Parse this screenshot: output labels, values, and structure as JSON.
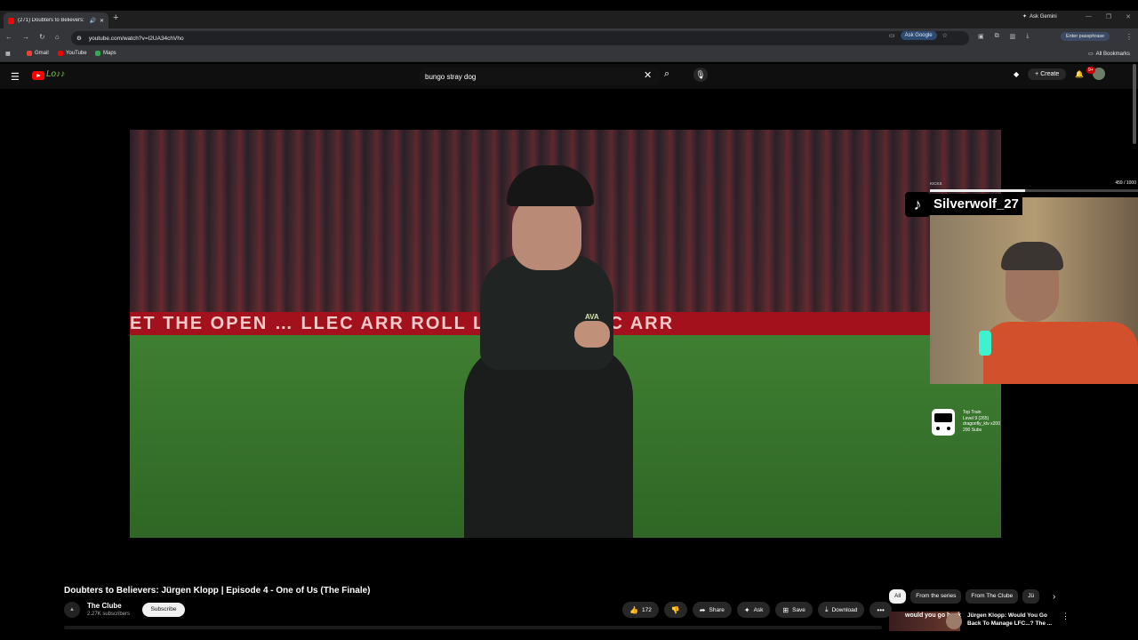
{
  "browser": {
    "tab_title": "(271) Doubters to Believers:",
    "new_tab": "+",
    "ask_gemini": "Ask Gemini",
    "url": "youtube.com/watch?v=I2UA34chVho",
    "ask_google": "Ask Google",
    "passphrase": "Enter passphrase",
    "bookmarks": [
      {
        "label": "Gmail",
        "color": "#ea4335"
      },
      {
        "label": "YouTube",
        "color": "#ff0000"
      },
      {
        "label": "Maps",
        "color": "#34a853"
      }
    ],
    "all_bookmarks": "All Bookmarks"
  },
  "youtube": {
    "search_query": "bungo stray dog",
    "create_label": "Create",
    "notif_badge": "9+",
    "doodle": "Lo♪♪"
  },
  "video": {
    "adboard_text": "ET THE OPEN … LLEC ARR          ROLL LEC ARR     LLEC ARR",
    "kick_player": "AVA"
  },
  "overlay": {
    "kicks_label": "KICKS",
    "kicks_count": "459 / 1000",
    "kicks_progress": 0.459,
    "tiktok_username": "Silverwolf_27",
    "train_title": "Top Train",
    "train_level": "Level 9 (265)",
    "train_user": "dragonfly_ktv x200",
    "train_subs": "200 Subs"
  },
  "info": {
    "title": "Doubters to Believers: Jürgen Klopp | Episode 4 - One of Us (The Finale)",
    "channel": "The Clube",
    "subscribers": "2.27K subscribers",
    "subscribe": "Subscribe",
    "actions": [
      {
        "icon": "thumbs-up-icon",
        "glyph": "👍",
        "label": "172"
      },
      {
        "icon": "thumbs-down-icon",
        "glyph": "👎",
        "label": ""
      },
      {
        "icon": "share-icon",
        "glyph": "➦",
        "label": "Share"
      },
      {
        "icon": "ask-icon",
        "glyph": "✦",
        "label": "Ask"
      },
      {
        "icon": "save-icon",
        "glyph": "⊞",
        "label": "Save"
      },
      {
        "icon": "download-icon",
        "glyph": "⤓",
        "label": "Download"
      },
      {
        "icon": "more-icon",
        "glyph": "•••",
        "label": ""
      }
    ],
    "chips": [
      "All",
      "From the series",
      "From The Clube",
      "Jü"
    ],
    "reco_thumb_text": "would you go back",
    "reco_title": "Jürgen Klopp: Would You Go Back To Manage LFC...? The ..."
  }
}
